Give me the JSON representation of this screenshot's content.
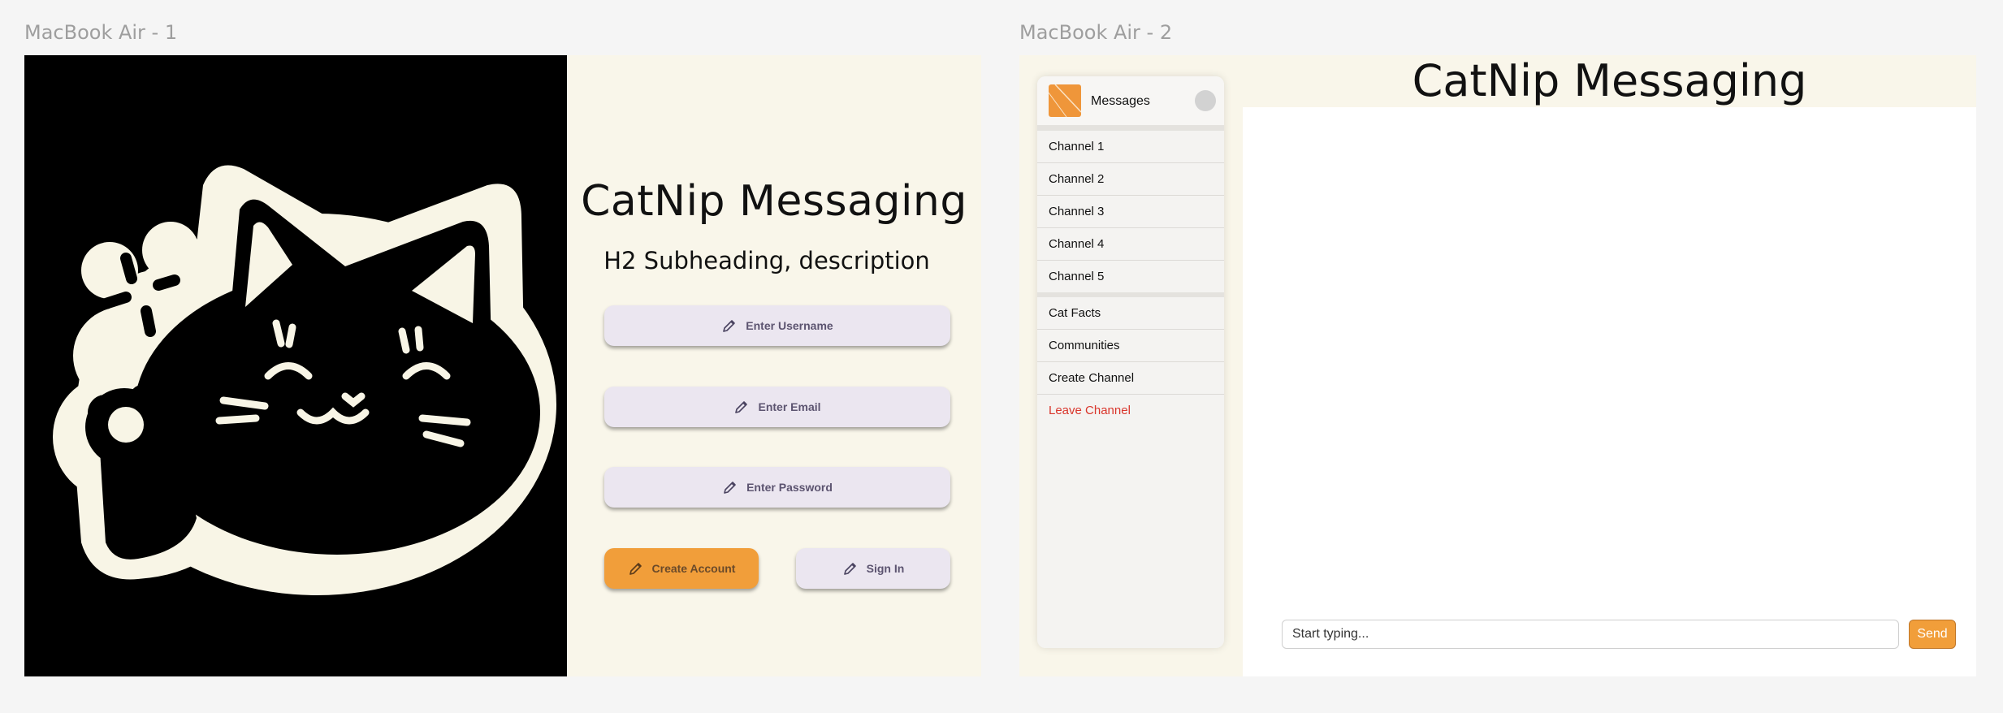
{
  "frames": {
    "frame1_label": "MacBook Air - 1",
    "frame2_label": "MacBook Air - 2"
  },
  "login": {
    "title": "CatNip Messaging",
    "subtitle": "H2 Subheading, description",
    "username_placeholder": "Enter Username",
    "email_placeholder": "Enter Email",
    "password_placeholder": "Enter Password",
    "create_account_label": "Create Account",
    "sign_in_label": "Sign In"
  },
  "messaging": {
    "title": "CatNip Messaging",
    "sidebar": {
      "title": "Messages",
      "channels": [
        "Channel 1",
        "Channel 2",
        "Channel 3",
        "Channel 4",
        "Channel 5"
      ],
      "actions": [
        "Cat Facts",
        "Communities",
        "Create Channel",
        "Leave Channel"
      ]
    },
    "input_placeholder": "Start typing...",
    "send_label": "Send"
  },
  "colors": {
    "accent": "#f19e3a",
    "panel_bg": "#f9f6ea",
    "input_bg": "#ebe6f0",
    "danger": "#d9352b"
  },
  "icons": {
    "field_icon": "pencil-icon",
    "hero": "lucky-cat-illustration"
  }
}
